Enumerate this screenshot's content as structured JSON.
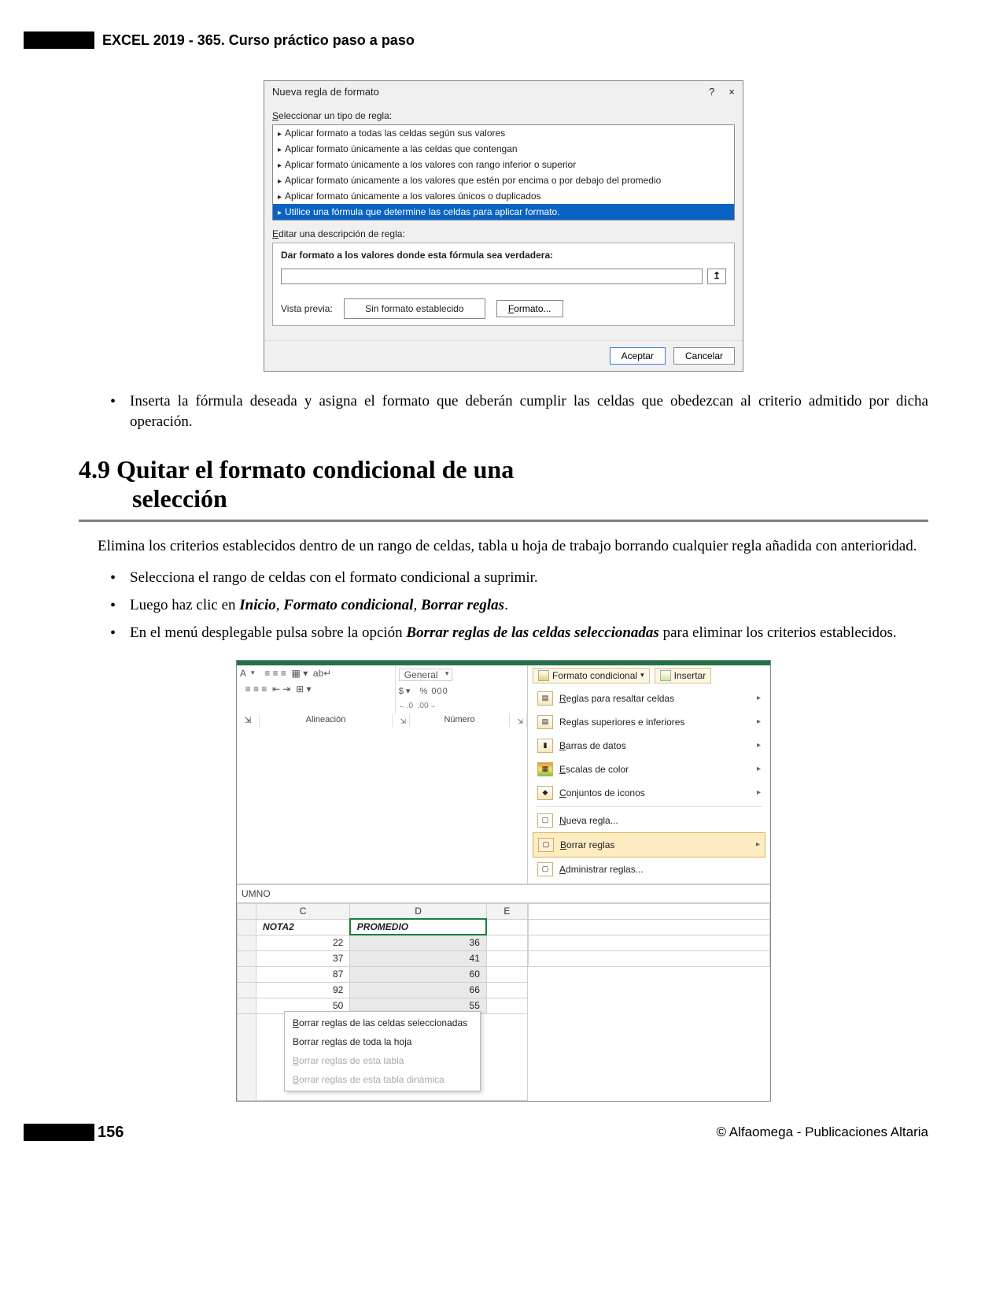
{
  "header": {
    "title": "EXCEL 2019 - 365. Curso práctico paso a paso"
  },
  "dialog1": {
    "title": "Nueva regla de formato",
    "help": "?",
    "close": "×",
    "select_label": "Seleccionar un tipo de regla:",
    "rules": [
      "Aplicar formato a todas las celdas según sus valores",
      "Aplicar formato únicamente a las celdas que contengan",
      "Aplicar formato únicamente a los valores con rango inferior o superior",
      "Aplicar formato únicamente a los valores que estén por encima o por debajo del promedio",
      "Aplicar formato únicamente a los valores únicos o duplicados",
      "Utilice una fórmula que determine las celdas para aplicar formato."
    ],
    "edit_label": "Editar una descripción de regla:",
    "formula_caption": "Dar formato a los valores donde esta fórmula sea verdadera:",
    "picker": "↥",
    "preview_label": "Vista previa:",
    "preview_value": "Sin formato establecido",
    "format_btn": "Formato...",
    "ok": "Aceptar",
    "cancel": "Cancelar"
  },
  "body": {
    "bullet1": "Inserta la fórmula deseada y asigna el formato que deberán cumplir las celdas que obedezcan al criterio admitido por dicha operación.",
    "sec_title_l1": "4.9 Quitar el formato condicional de una",
    "sec_title_l2": "selección",
    "para1": "Elimina los criterios establecidos dentro de un rango de celdas, tabla u hoja de trabajo borrando cualquier regla añadida con anterioridad.",
    "b_sel": "Selecciona el rango de celdas con el formato condicional a suprimir.",
    "b_luego_a": "Luego haz clic en ",
    "b_luego_inicio": "Inicio",
    "b_luego_sep": ", ",
    "b_luego_fc": "Formato condicional",
    "b_luego_br": "Borrar reglas",
    "b_luego_dot": ".",
    "b_menu_a": "En el menú desplegable pulsa sobre la opción ",
    "b_menu_bold": "Borrar reglas de las celdas seleccionadas",
    "b_menu_b": " para eliminar los criterios establecidos."
  },
  "fig2": {
    "general": "General",
    "pct": "% 000",
    "dec": "←0  .00→",
    "grp_align": "Alineación",
    "grp_num": "Número",
    "fc_btn": "Formato condicional",
    "ins_btn": "Insertar",
    "menu": {
      "m1": "Reglas para resaltar celdas",
      "m2": "Reglas superiores e inferiores",
      "m3": "Barras de datos",
      "m4": "Escalas de color",
      "m5": "Conjuntos de iconos",
      "m6": "Nueva regla...",
      "m7": "Borrar reglas",
      "m8": "Administrar reglas..."
    },
    "formula_bar": "UMNO",
    "cols": [
      "C",
      "D",
      "E"
    ],
    "hdr1": "NOTA2",
    "hdr2": "PROMEDIO",
    "rows": [
      [
        22,
        36
      ],
      [
        37,
        41
      ],
      [
        87,
        60
      ],
      [
        92,
        66
      ],
      [
        50,
        55
      ]
    ],
    "submenu": {
      "s1": "Borrar reglas de las celdas seleccionadas",
      "s2": "Borrar reglas de toda la hoja",
      "s3": "Borrar reglas de esta tabla",
      "s4": "Borrar reglas de esta tabla dinámica"
    }
  },
  "footer": {
    "page": "156",
    "copyright": "© Alfaomega - Publicaciones Altaria"
  }
}
